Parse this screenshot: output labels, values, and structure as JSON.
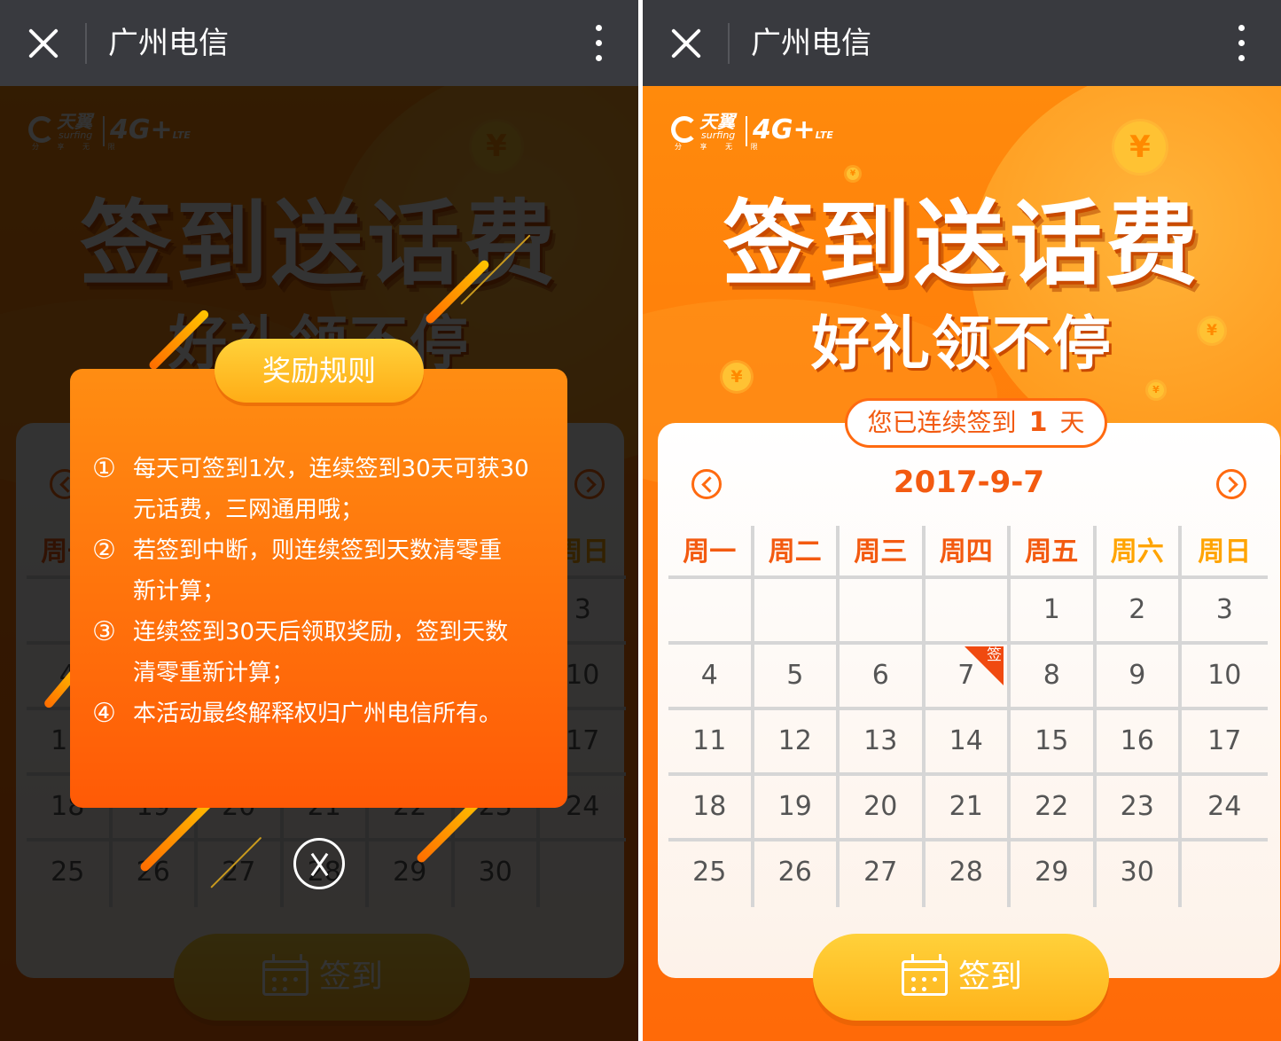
{
  "topbar": {
    "title": "广州电信"
  },
  "logo": {
    "brand": "天翼",
    "brand_en": "surfing",
    "slogan": "分 享 无 限",
    "network": "4G",
    "network_plus": "+",
    "lte": "LTE"
  },
  "hero": {
    "title": "签到送话费",
    "subtitle": "好礼领不停",
    "coin_symbol": "¥"
  },
  "streak": {
    "prefix": "您已连续签到",
    "days": "1",
    "suffix": "天"
  },
  "calendar": {
    "date": "2017-9-7",
    "weekdays": [
      "周一",
      "周二",
      "周三",
      "周四",
      "周五",
      "周六",
      "周日"
    ],
    "weeks": [
      [
        "",
        "",
        "",
        "",
        "1",
        "2",
        "3"
      ],
      [
        "4",
        "5",
        "6",
        "7",
        "8",
        "9",
        "10"
      ],
      [
        "11",
        "12",
        "13",
        "14",
        "15",
        "16",
        "17"
      ],
      [
        "18",
        "19",
        "20",
        "21",
        "22",
        "23",
        "24"
      ],
      [
        "25",
        "26",
        "27",
        "28",
        "29",
        "30",
        ""
      ]
    ],
    "signed_day": "7",
    "signed_tag": "签"
  },
  "sign_button": {
    "label": "签到"
  },
  "modal": {
    "title": "奖励规则",
    "rules": [
      {
        "n": "①",
        "lines": [
          "每天可签到1次，连续签到30天可获30",
          "元话费，三网通用哦；"
        ]
      },
      {
        "n": "②",
        "lines": [
          "若签到中断，则连续签到天数清零重",
          "新计算；"
        ]
      },
      {
        "n": "③",
        "lines": [
          "连续签到30天后领取奖励，签到天数",
          "清零重新计算；"
        ]
      },
      {
        "n": "④",
        "lines": [
          "本活动最终解释权归广州电信所有。"
        ]
      }
    ]
  },
  "colors": {
    "accent": "#f35a10",
    "weekend": "#ffa400",
    "topbar": "#393a3f",
    "gold": "#ffc233"
  },
  "icons": [
    "close-icon",
    "more-icon",
    "prev-month-icon",
    "next-month-icon",
    "calendar-icon",
    "modal-close-icon",
    "coin-icon"
  ]
}
